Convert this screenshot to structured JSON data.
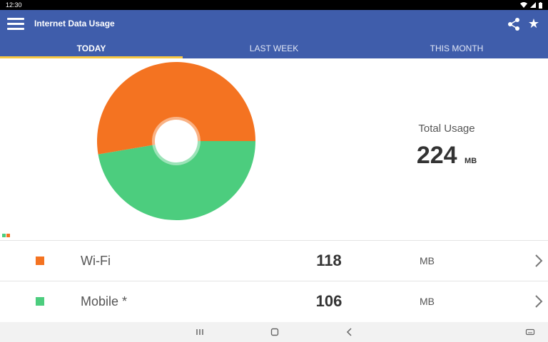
{
  "status": {
    "time": "12:30"
  },
  "appbar": {
    "title": "Internet Data Usage"
  },
  "tabs": [
    {
      "label": "TODAY",
      "active": true
    },
    {
      "label": "LAST WEEK",
      "active": false
    },
    {
      "label": "THIS MONTH",
      "active": false
    }
  ],
  "summary": {
    "label": "Total Usage",
    "value": "224",
    "unit": "MB"
  },
  "colors": {
    "wifi": "#f47321",
    "mobile": "#4ccd7e",
    "appbar": "#3f5dab",
    "tab_indicator": "#f7c844"
  },
  "rows": [
    {
      "label": "Wi-Fi",
      "value": "118",
      "unit": "MB",
      "color": "#f47321"
    },
    {
      "label": "Mobile *",
      "value": "106",
      "unit": "MB",
      "color": "#4ccd7e"
    }
  ],
  "chart_data": {
    "type": "pie",
    "categories": [
      "Wi-Fi",
      "Mobile *"
    ],
    "values": [
      118,
      106
    ],
    "colors": [
      "#f47321",
      "#4ccd7e"
    ],
    "donut": true
  },
  "icons": {
    "menu": "menu-icon",
    "share": "share-icon",
    "star": "star-icon",
    "chevron": "chevron-right-icon"
  }
}
